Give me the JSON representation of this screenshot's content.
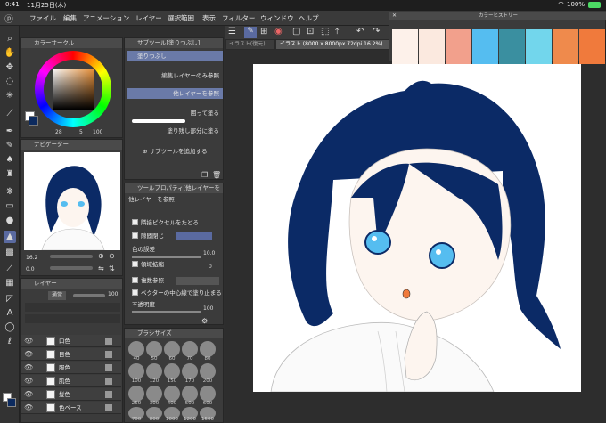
{
  "status": {
    "time": "0:41",
    "date": "11月25日(木)",
    "battery": "100%"
  },
  "menu": [
    "ファイル",
    "編集",
    "アニメーション",
    "レイヤー",
    "選択範囲",
    "表示",
    "フィルター",
    "ウィンドウ",
    "ヘルプ"
  ],
  "color_circle": {
    "title": "カラーサークル",
    "h": "28",
    "s": "5",
    "v": "100"
  },
  "navigator": {
    "title": "ナビゲーター",
    "zoom": "16.2",
    "angle": "0.0"
  },
  "subtool": {
    "title": "サブツール[塗りつぶし]",
    "items": [
      "塗りつぶし",
      "編集レイヤーのみ参照",
      "他レイヤーを参照",
      "囲って塗る",
      "塗り残し部分に塗る"
    ],
    "add_label": "サブツールを追加する"
  },
  "tool_property": {
    "title": "ツールプロパティ[他レイヤーを",
    "subtitle": "他レイヤーを参照",
    "rows": [
      {
        "label": "隣接ピクセルをたどる"
      },
      {
        "label": "隙間閉じ"
      },
      {
        "label": "色の誤差",
        "value": "10.0"
      },
      {
        "label": "領域拡縮",
        "value": "0"
      },
      {
        "label": "複数参照"
      },
      {
        "label": "ベクターの中心線で塗り止まる"
      },
      {
        "label": "不透明度",
        "value": "100"
      }
    ]
  },
  "layer_panel": {
    "title": "レイヤー",
    "blend": "通常",
    "opacity": "100",
    "layers": [
      "口色",
      "目色",
      "服色",
      "肌色",
      "髪色",
      "色ベース"
    ]
  },
  "brush_size": {
    "title": "ブラシサイズ",
    "sizes": [
      "40",
      "50",
      "60",
      "70",
      "80",
      "100",
      "120",
      "150",
      "170",
      "200",
      "250",
      "300",
      "400",
      "500",
      "600",
      "700",
      "800",
      "1000",
      "1200",
      "1500",
      "1700",
      "2000"
    ]
  },
  "document_tab": "イラスト (8000 x 8000px 72dpi 16.2%)",
  "tab_prev": "イラスト(復元)",
  "color_history": {
    "title": "カラーヒストリー",
    "colors": [
      "#fdf1ea",
      "#fbe9df",
      "#f2a08c",
      "#55bdf0",
      "#3a8fa0",
      "#72d6ec",
      "#ef8a4c",
      "#f07a3c"
    ]
  }
}
